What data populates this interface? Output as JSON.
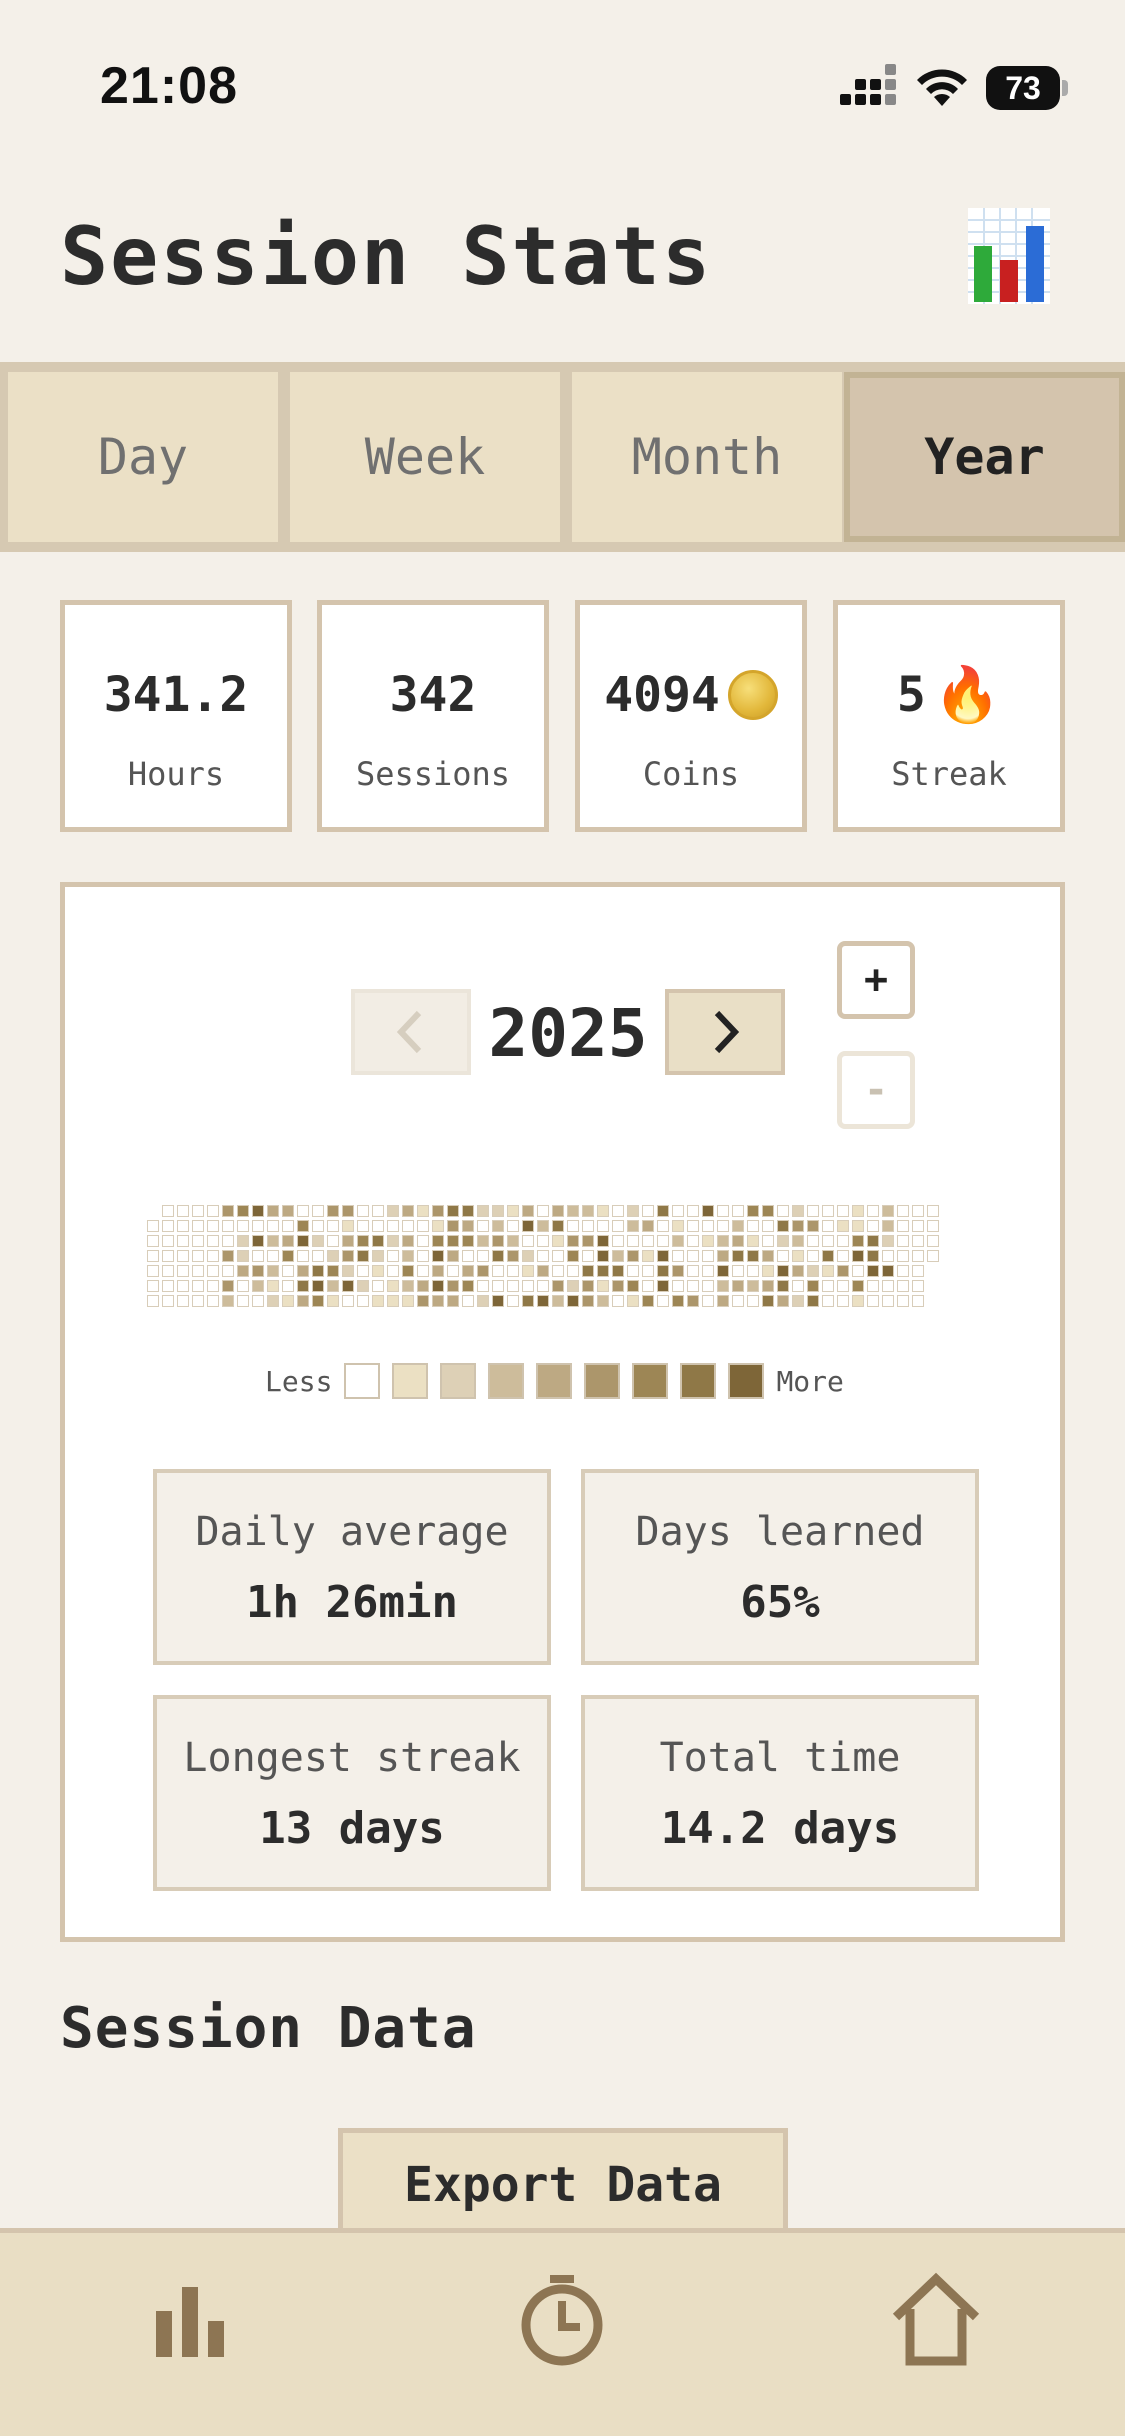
{
  "status_bar": {
    "time": "21:08",
    "battery": "73"
  },
  "header": {
    "title": "Session Stats",
    "icon": "bar-chart-icon"
  },
  "tabs": [
    {
      "label": "Day",
      "active": false
    },
    {
      "label": "Week",
      "active": false
    },
    {
      "label": "Month",
      "active": false
    },
    {
      "label": "Year",
      "active": true
    }
  ],
  "summary": [
    {
      "value": "341.2",
      "label": "Hours",
      "icon": ""
    },
    {
      "value": "342",
      "label": "Sessions",
      "icon": ""
    },
    {
      "value": "4094",
      "label": "Coins",
      "icon": "coin-icon"
    },
    {
      "value": "5",
      "label": "Streak",
      "icon": "fire-icon"
    }
  ],
  "calendar": {
    "year": "2025",
    "zoom_in": "+",
    "zoom_out": "-",
    "legend_less": "Less",
    "legend_more": "More",
    "legend_colors": [
      "#ffffff",
      "#ebe0c3",
      "#ddd0b6",
      "#cdbc9b",
      "#bda983",
      "#ac966b",
      "#9d8655",
      "#8f7847",
      "#7e6638"
    ]
  },
  "metrics": [
    {
      "label": "Daily average",
      "value": "1h 26min"
    },
    {
      "label": "Days learned",
      "value": "65%"
    },
    {
      "label": "Longest streak",
      "value": "13 days"
    },
    {
      "label": "Total time",
      "value": "14.2 days"
    }
  ],
  "session_data": {
    "title": "Session Data",
    "export_label": "Export Data"
  },
  "nav": [
    {
      "icon": "stats-icon"
    },
    {
      "icon": "timer-icon"
    },
    {
      "icon": "home-icon"
    }
  ]
}
